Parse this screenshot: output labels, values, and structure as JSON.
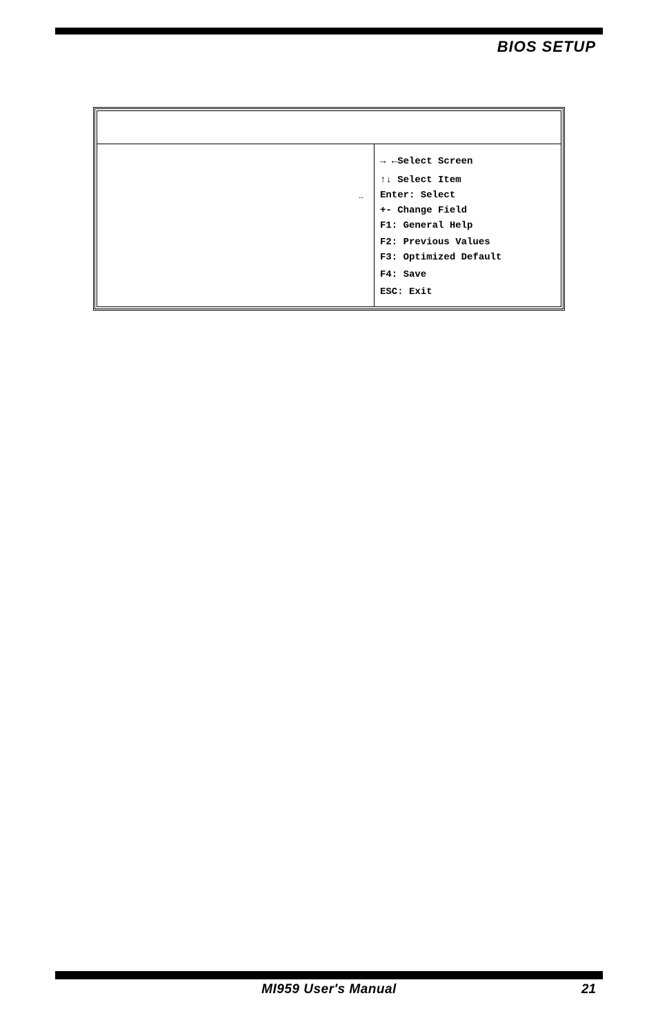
{
  "header": {
    "title": "BIOS SETUP"
  },
  "bios": {
    "ellipsis": "…",
    "help": {
      "selectScreen": "→ ←Select Screen",
      "selectItem": "↑↓ Select Item",
      "enter": "Enter: Select",
      "changeField": "+-  Change Field",
      "f1": "F1: General Help",
      "f2": "F2: Previous Values",
      "f3": "F3: Optimized Default",
      "f4": "F4: Save",
      "esc": "ESC: Exit"
    }
  },
  "footer": {
    "manual": "MI959 User's Manual",
    "page": "21"
  }
}
